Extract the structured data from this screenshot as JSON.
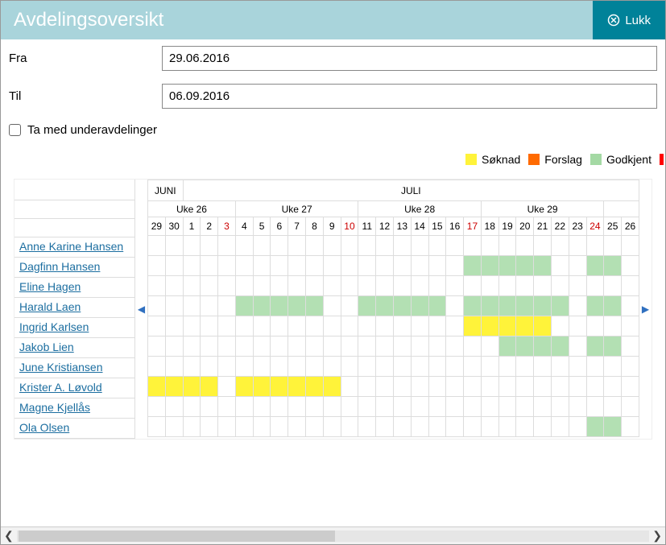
{
  "header": {
    "title": "Avdelingsoversikt",
    "close_label": "Lukk"
  },
  "form": {
    "from_label": "Fra",
    "to_label": "Til",
    "from_value": "29.06.2016",
    "to_value": "06.09.2016",
    "include_sub_label": "Ta med underavdelinger",
    "include_sub_checked": false
  },
  "legend": {
    "application": "Søknad",
    "proposal": "Forslag",
    "approved": "Godkjent",
    "colors": {
      "application": "#fff33a",
      "proposal": "#ff6a00",
      "approved": "#a4d9a4"
    }
  },
  "calendar": {
    "months": [
      {
        "label": "JUNI",
        "span": 2
      },
      {
        "label": "JULI",
        "span": 26
      }
    ],
    "weeks": [
      {
        "label": "Uke 26",
        "span": 5
      },
      {
        "label": "Uke 27",
        "span": 7
      },
      {
        "label": "Uke 28",
        "span": 7
      },
      {
        "label": "Uke 29",
        "span": 7
      },
      {
        "label": "",
        "span": 2
      }
    ],
    "days": [
      "29",
      "30",
      "1",
      "2",
      "3",
      "4",
      "5",
      "6",
      "7",
      "8",
      "9",
      "10",
      "11",
      "12",
      "13",
      "14",
      "15",
      "16",
      "17",
      "18",
      "19",
      "20",
      "21",
      "22",
      "23",
      "24",
      "25",
      "26"
    ],
    "red_days": [
      4,
      11,
      18,
      25
    ]
  },
  "rows": [
    {
      "name": "Anne Karine Hansen",
      "cells": {}
    },
    {
      "name": "Dagfinn Hansen",
      "cells": {
        "18": "g",
        "19": "g",
        "20": "g",
        "21": "g",
        "22": "g",
        "25": "g",
        "26": "g"
      }
    },
    {
      "name": "Eline Hagen",
      "cells": {}
    },
    {
      "name": "Harald Laen",
      "cells": {
        "5": "g",
        "6": "g",
        "7": "g",
        "8": "g",
        "9": "g",
        "12": "g",
        "13": "g",
        "14": "g",
        "15": "g",
        "16": "g",
        "18": "g",
        "19": "g",
        "20": "g",
        "21": "g",
        "22": "g",
        "23": "g",
        "25": "g",
        "26": "g"
      }
    },
    {
      "name": "Ingrid Karlsen",
      "cells": {
        "18": "y",
        "19": "y",
        "20": "y",
        "21": "y",
        "22": "y"
      }
    },
    {
      "name": "Jakob Lien",
      "cells": {
        "20": "g",
        "21": "g",
        "22": "g",
        "23": "g",
        "25": "g",
        "26": "g"
      }
    },
    {
      "name": "June Kristiansen",
      "cells": {}
    },
    {
      "name": "Krister A. Løvold",
      "cells": {
        "0": "y",
        "1": "y",
        "2": "y",
        "3": "y",
        "5": "y",
        "6": "y",
        "7": "y",
        "8": "y",
        "9": "y",
        "10": "y"
      }
    },
    {
      "name": "Magne Kjellås",
      "cells": {}
    },
    {
      "name": "Ola Olsen",
      "cells": {
        "25": "g",
        "26": "g"
      }
    }
  ]
}
